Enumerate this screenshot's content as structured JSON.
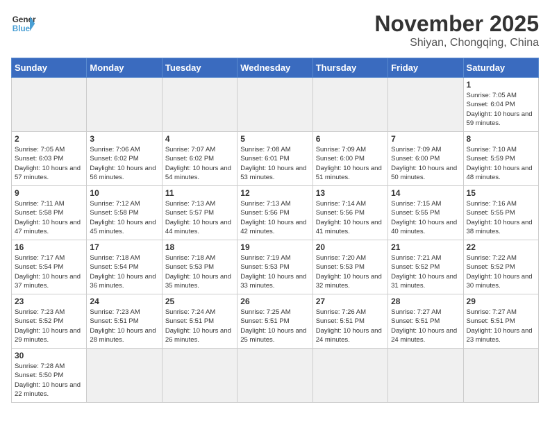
{
  "header": {
    "logo_general": "General",
    "logo_blue": "Blue",
    "month_year": "November 2025",
    "location": "Shiyan, Chongqing, China"
  },
  "weekdays": [
    "Sunday",
    "Monday",
    "Tuesday",
    "Wednesday",
    "Thursday",
    "Friday",
    "Saturday"
  ],
  "weeks": [
    [
      {
        "day": "",
        "sunrise": "",
        "sunset": "",
        "daylight": ""
      },
      {
        "day": "",
        "sunrise": "",
        "sunset": "",
        "daylight": ""
      },
      {
        "day": "",
        "sunrise": "",
        "sunset": "",
        "daylight": ""
      },
      {
        "day": "",
        "sunrise": "",
        "sunset": "",
        "daylight": ""
      },
      {
        "day": "",
        "sunrise": "",
        "sunset": "",
        "daylight": ""
      },
      {
        "day": "",
        "sunrise": "",
        "sunset": "",
        "daylight": ""
      },
      {
        "day": "1",
        "sunrise": "Sunrise: 7:05 AM",
        "sunset": "Sunset: 6:04 PM",
        "daylight": "Daylight: 10 hours and 59 minutes."
      }
    ],
    [
      {
        "day": "2",
        "sunrise": "Sunrise: 7:05 AM",
        "sunset": "Sunset: 6:03 PM",
        "daylight": "Daylight: 10 hours and 57 minutes."
      },
      {
        "day": "3",
        "sunrise": "Sunrise: 7:06 AM",
        "sunset": "Sunset: 6:02 PM",
        "daylight": "Daylight: 10 hours and 56 minutes."
      },
      {
        "day": "4",
        "sunrise": "Sunrise: 7:07 AM",
        "sunset": "Sunset: 6:02 PM",
        "daylight": "Daylight: 10 hours and 54 minutes."
      },
      {
        "day": "5",
        "sunrise": "Sunrise: 7:08 AM",
        "sunset": "Sunset: 6:01 PM",
        "daylight": "Daylight: 10 hours and 53 minutes."
      },
      {
        "day": "6",
        "sunrise": "Sunrise: 7:09 AM",
        "sunset": "Sunset: 6:00 PM",
        "daylight": "Daylight: 10 hours and 51 minutes."
      },
      {
        "day": "7",
        "sunrise": "Sunrise: 7:09 AM",
        "sunset": "Sunset: 6:00 PM",
        "daylight": "Daylight: 10 hours and 50 minutes."
      },
      {
        "day": "8",
        "sunrise": "Sunrise: 7:10 AM",
        "sunset": "Sunset: 5:59 PM",
        "daylight": "Daylight: 10 hours and 48 minutes."
      }
    ],
    [
      {
        "day": "9",
        "sunrise": "Sunrise: 7:11 AM",
        "sunset": "Sunset: 5:58 PM",
        "daylight": "Daylight: 10 hours and 47 minutes."
      },
      {
        "day": "10",
        "sunrise": "Sunrise: 7:12 AM",
        "sunset": "Sunset: 5:58 PM",
        "daylight": "Daylight: 10 hours and 45 minutes."
      },
      {
        "day": "11",
        "sunrise": "Sunrise: 7:13 AM",
        "sunset": "Sunset: 5:57 PM",
        "daylight": "Daylight: 10 hours and 44 minutes."
      },
      {
        "day": "12",
        "sunrise": "Sunrise: 7:13 AM",
        "sunset": "Sunset: 5:56 PM",
        "daylight": "Daylight: 10 hours and 42 minutes."
      },
      {
        "day": "13",
        "sunrise": "Sunrise: 7:14 AM",
        "sunset": "Sunset: 5:56 PM",
        "daylight": "Daylight: 10 hours and 41 minutes."
      },
      {
        "day": "14",
        "sunrise": "Sunrise: 7:15 AM",
        "sunset": "Sunset: 5:55 PM",
        "daylight": "Daylight: 10 hours and 40 minutes."
      },
      {
        "day": "15",
        "sunrise": "Sunrise: 7:16 AM",
        "sunset": "Sunset: 5:55 PM",
        "daylight": "Daylight: 10 hours and 38 minutes."
      }
    ],
    [
      {
        "day": "16",
        "sunrise": "Sunrise: 7:17 AM",
        "sunset": "Sunset: 5:54 PM",
        "daylight": "Daylight: 10 hours and 37 minutes."
      },
      {
        "day": "17",
        "sunrise": "Sunrise: 7:18 AM",
        "sunset": "Sunset: 5:54 PM",
        "daylight": "Daylight: 10 hours and 36 minutes."
      },
      {
        "day": "18",
        "sunrise": "Sunrise: 7:18 AM",
        "sunset": "Sunset: 5:53 PM",
        "daylight": "Daylight: 10 hours and 35 minutes."
      },
      {
        "day": "19",
        "sunrise": "Sunrise: 7:19 AM",
        "sunset": "Sunset: 5:53 PM",
        "daylight": "Daylight: 10 hours and 33 minutes."
      },
      {
        "day": "20",
        "sunrise": "Sunrise: 7:20 AM",
        "sunset": "Sunset: 5:53 PM",
        "daylight": "Daylight: 10 hours and 32 minutes."
      },
      {
        "day": "21",
        "sunrise": "Sunrise: 7:21 AM",
        "sunset": "Sunset: 5:52 PM",
        "daylight": "Daylight: 10 hours and 31 minutes."
      },
      {
        "day": "22",
        "sunrise": "Sunrise: 7:22 AM",
        "sunset": "Sunset: 5:52 PM",
        "daylight": "Daylight: 10 hours and 30 minutes."
      }
    ],
    [
      {
        "day": "23",
        "sunrise": "Sunrise: 7:23 AM",
        "sunset": "Sunset: 5:52 PM",
        "daylight": "Daylight: 10 hours and 29 minutes."
      },
      {
        "day": "24",
        "sunrise": "Sunrise: 7:23 AM",
        "sunset": "Sunset: 5:51 PM",
        "daylight": "Daylight: 10 hours and 28 minutes."
      },
      {
        "day": "25",
        "sunrise": "Sunrise: 7:24 AM",
        "sunset": "Sunset: 5:51 PM",
        "daylight": "Daylight: 10 hours and 26 minutes."
      },
      {
        "day": "26",
        "sunrise": "Sunrise: 7:25 AM",
        "sunset": "Sunset: 5:51 PM",
        "daylight": "Daylight: 10 hours and 25 minutes."
      },
      {
        "day": "27",
        "sunrise": "Sunrise: 7:26 AM",
        "sunset": "Sunset: 5:51 PM",
        "daylight": "Daylight: 10 hours and 24 minutes."
      },
      {
        "day": "28",
        "sunrise": "Sunrise: 7:27 AM",
        "sunset": "Sunset: 5:51 PM",
        "daylight": "Daylight: 10 hours and 24 minutes."
      },
      {
        "day": "29",
        "sunrise": "Sunrise: 7:27 AM",
        "sunset": "Sunset: 5:51 PM",
        "daylight": "Daylight: 10 hours and 23 minutes."
      }
    ],
    [
      {
        "day": "30",
        "sunrise": "Sunrise: 7:28 AM",
        "sunset": "Sunset: 5:50 PM",
        "daylight": "Daylight: 10 hours and 22 minutes."
      },
      {
        "day": "",
        "sunrise": "",
        "sunset": "",
        "daylight": ""
      },
      {
        "day": "",
        "sunrise": "",
        "sunset": "",
        "daylight": ""
      },
      {
        "day": "",
        "sunrise": "",
        "sunset": "",
        "daylight": ""
      },
      {
        "day": "",
        "sunrise": "",
        "sunset": "",
        "daylight": ""
      },
      {
        "day": "",
        "sunrise": "",
        "sunset": "",
        "daylight": ""
      },
      {
        "day": "",
        "sunrise": "",
        "sunset": "",
        "daylight": ""
      }
    ]
  ]
}
